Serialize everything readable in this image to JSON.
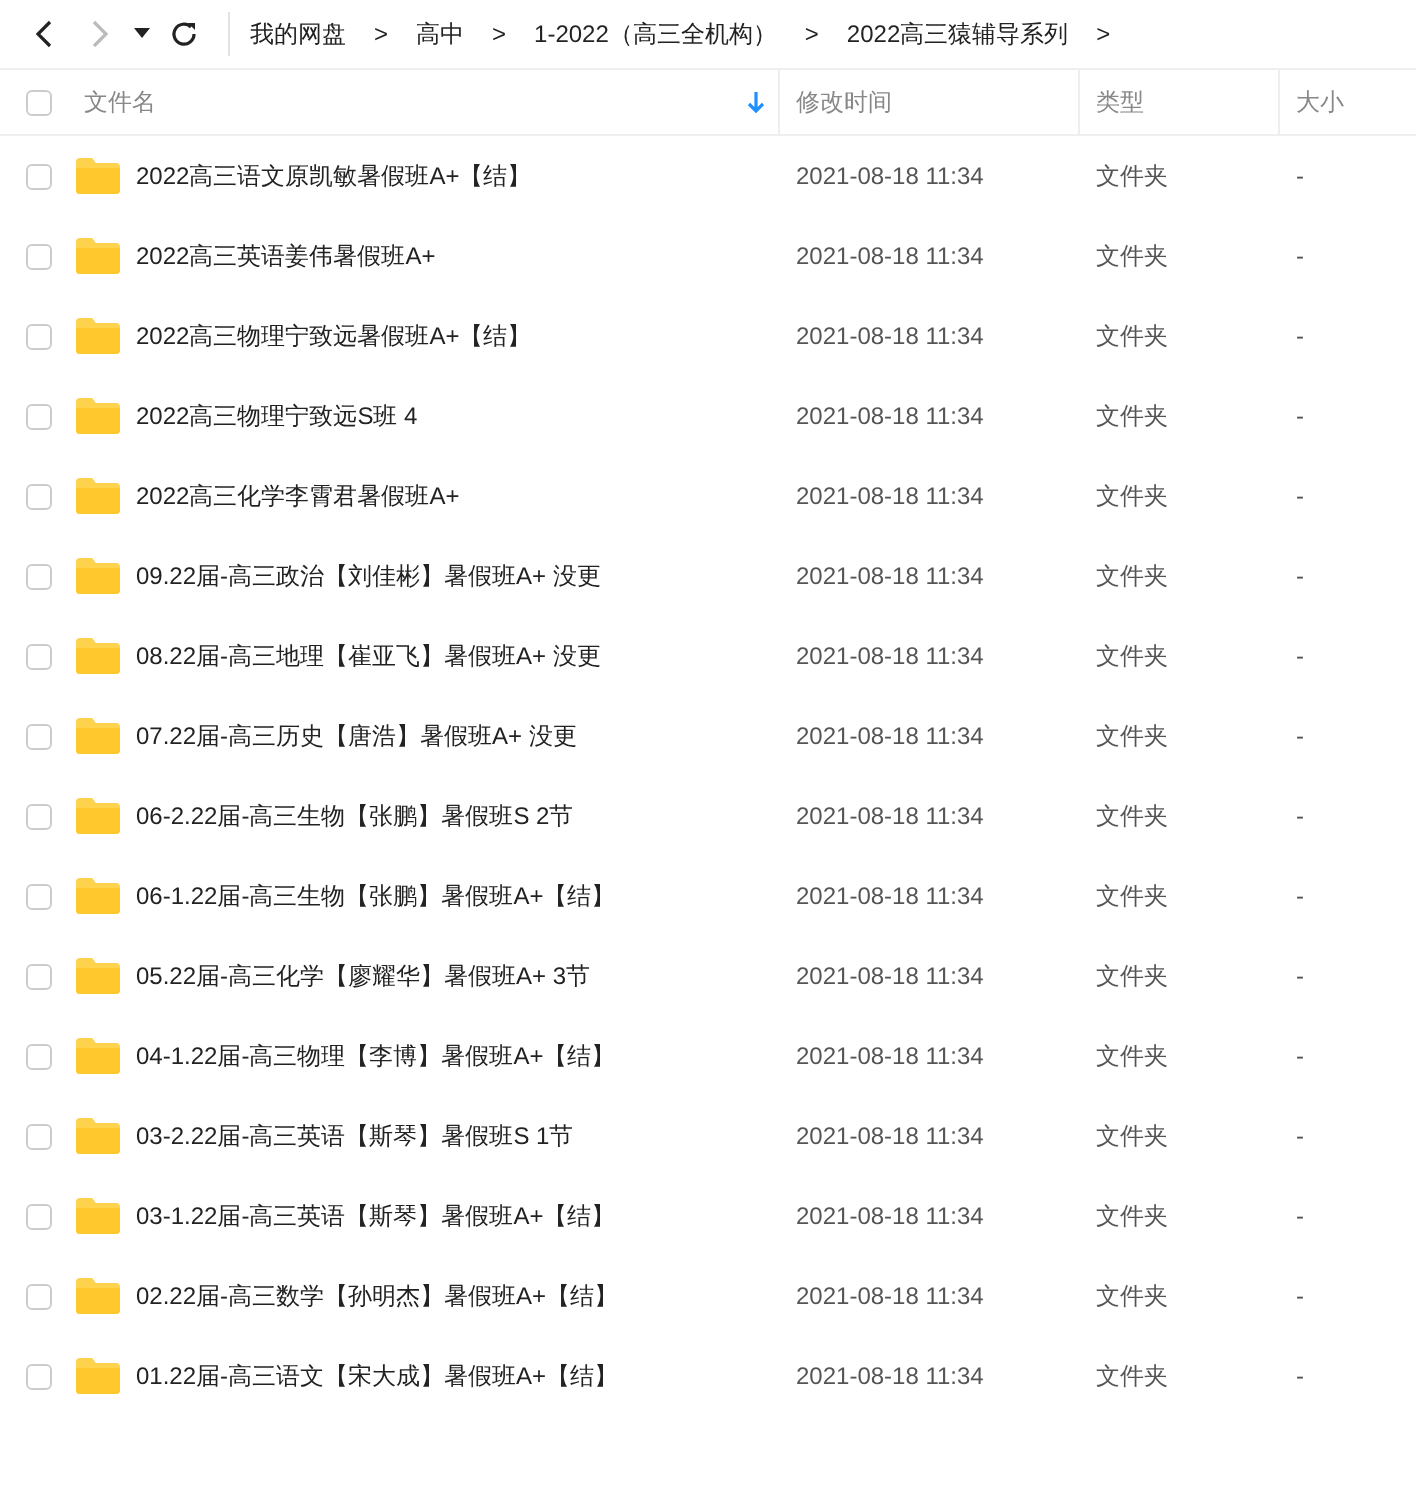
{
  "toolbar": {
    "back_disabled": false,
    "forward_disabled": true
  },
  "breadcrumb": [
    {
      "label": "我的网盘"
    },
    {
      "label": "高中"
    },
    {
      "label": "1-2022（高三全机构）"
    },
    {
      "label": "2022高三猿辅导系列"
    }
  ],
  "separator": ">",
  "all_selected": false,
  "columns": [
    {
      "label": "文件名",
      "sorted": true
    },
    {
      "label": "修改时间",
      "sorted": false
    },
    {
      "label": "类型",
      "sorted": false
    },
    {
      "label": "大小",
      "sorted": false
    }
  ],
  "rows": [
    {
      "name": "2022高三语文原凯敏暑假班A+【结】",
      "modified": "2021-08-18 11:34",
      "type": "文件夹",
      "size": "-",
      "selected": false
    },
    {
      "name": "2022高三英语姜伟暑假班A+",
      "modified": "2021-08-18 11:34",
      "type": "文件夹",
      "size": "-",
      "selected": false
    },
    {
      "name": "2022高三物理宁致远暑假班A+【结】",
      "modified": "2021-08-18 11:34",
      "type": "文件夹",
      "size": "-",
      "selected": false
    },
    {
      "name": "2022高三物理宁致远S班 4",
      "modified": "2021-08-18 11:34",
      "type": "文件夹",
      "size": "-",
      "selected": false
    },
    {
      "name": "2022高三化学李霄君暑假班A+",
      "modified": "2021-08-18 11:34",
      "type": "文件夹",
      "size": "-",
      "selected": false
    },
    {
      "name": "09.22届-高三政治【刘佳彬】暑假班A+ 没更",
      "modified": "2021-08-18 11:34",
      "type": "文件夹",
      "size": "-",
      "selected": false
    },
    {
      "name": "08.22届-高三地理【崔亚飞】暑假班A+ 没更",
      "modified": "2021-08-18 11:34",
      "type": "文件夹",
      "size": "-",
      "selected": false
    },
    {
      "name": "07.22届-高三历史【唐浩】暑假班A+ 没更",
      "modified": "2021-08-18 11:34",
      "type": "文件夹",
      "size": "-",
      "selected": false
    },
    {
      "name": "06-2.22届-高三生物【张鹏】暑假班S 2节",
      "modified": "2021-08-18 11:34",
      "type": "文件夹",
      "size": "-",
      "selected": false
    },
    {
      "name": "06-1.22届-高三生物【张鹏】暑假班A+【结】",
      "modified": "2021-08-18 11:34",
      "type": "文件夹",
      "size": "-",
      "selected": false
    },
    {
      "name": "05.22届-高三化学【廖耀华】暑假班A+ 3节",
      "modified": "2021-08-18 11:34",
      "type": "文件夹",
      "size": "-",
      "selected": false
    },
    {
      "name": "04-1.22届-高三物理【李博】暑假班A+【结】",
      "modified": "2021-08-18 11:34",
      "type": "文件夹",
      "size": "-",
      "selected": false
    },
    {
      "name": "03-2.22届-高三英语【斯琴】暑假班S 1节",
      "modified": "2021-08-18 11:34",
      "type": "文件夹",
      "size": "-",
      "selected": false
    },
    {
      "name": "03-1.22届-高三英语【斯琴】暑假班A+【结】",
      "modified": "2021-08-18 11:34",
      "type": "文件夹",
      "size": "-",
      "selected": false
    },
    {
      "name": "02.22届-高三数学【孙明杰】暑假班A+【结】",
      "modified": "2021-08-18 11:34",
      "type": "文件夹",
      "size": "-",
      "selected": false
    },
    {
      "name": "01.22届-高三语文【宋大成】暑假班A+【结】",
      "modified": "2021-08-18 11:34",
      "type": "文件夹",
      "size": "-",
      "selected": false
    }
  ]
}
